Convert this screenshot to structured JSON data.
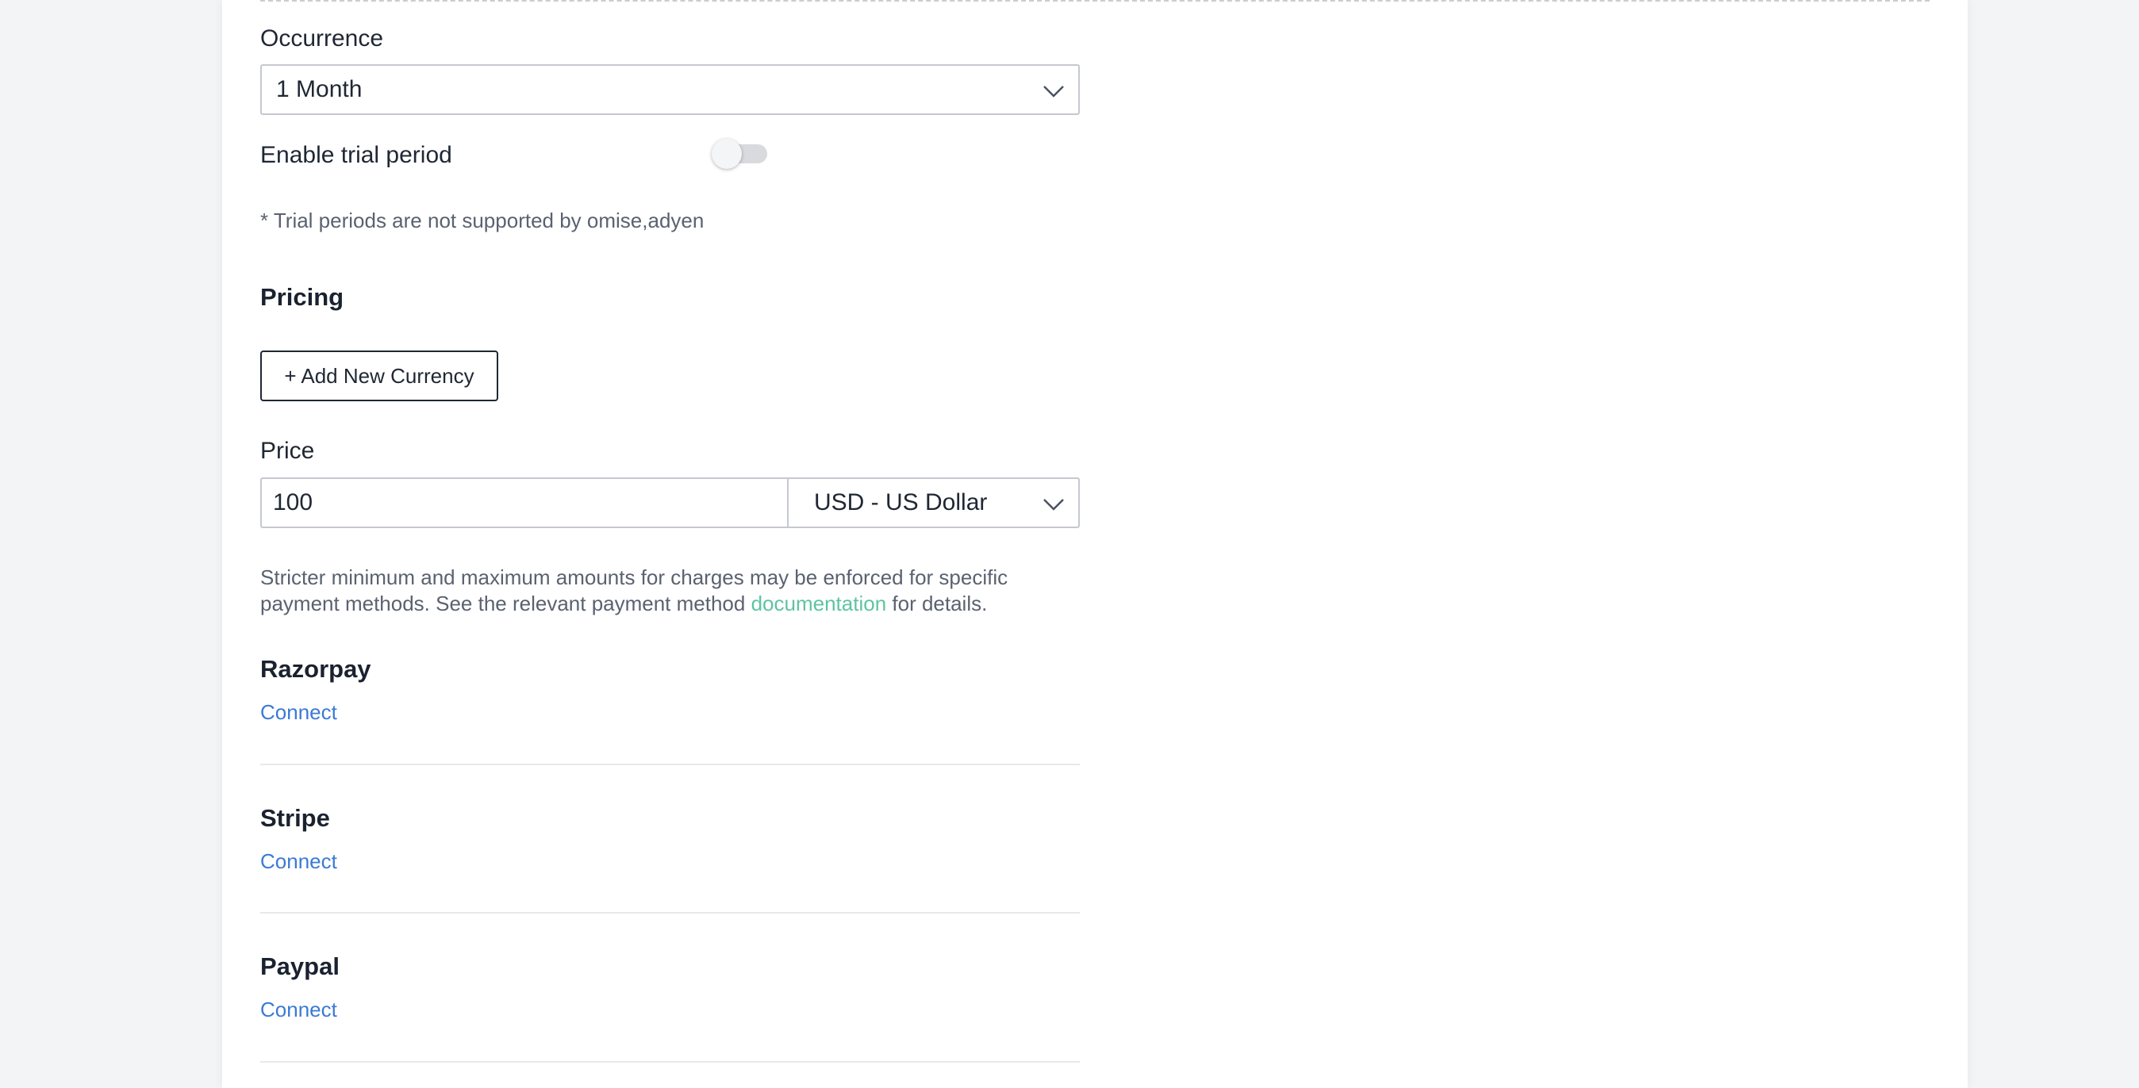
{
  "occurrence": {
    "label": "Occurrence",
    "selected": "1 Month"
  },
  "trial": {
    "label": "Enable trial period",
    "enabled": false,
    "note": "* Trial periods are not supported by omise,adyen"
  },
  "pricing": {
    "heading": "Pricing",
    "add_currency_label": "+ Add New Currency",
    "price_label": "Price",
    "price_value": "100",
    "currency_selected": "USD - US Dollar",
    "help_text_before": "Stricter minimum and maximum amounts for charges may be enforced for specific payment methods. See the relevant payment method ",
    "help_link": "documentation",
    "help_text_after": " for details."
  },
  "gateways": [
    {
      "name": "Razorpay",
      "action": "Connect"
    },
    {
      "name": "Stripe",
      "action": "Connect"
    },
    {
      "name": "Paypal",
      "action": "Connect"
    }
  ],
  "colors": {
    "link": "#3b7ad6",
    "doc_link": "#5ec4a0",
    "text": "#1f2733",
    "muted": "#5a6270"
  },
  "icons": {
    "select_chevron": "chevron-down-icon"
  }
}
